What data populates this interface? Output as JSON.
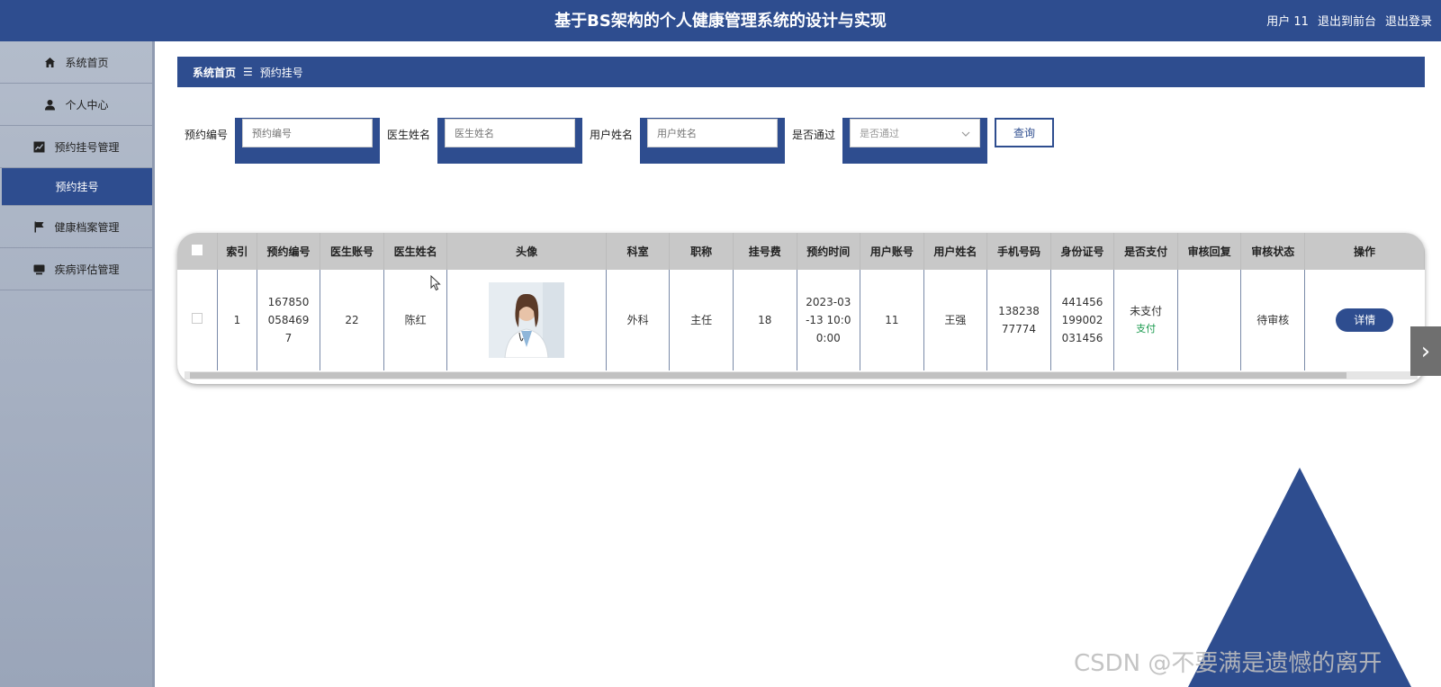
{
  "header": {
    "title": "基于BS架构的个人健康管理系统的设计与实现",
    "user": "用户 11",
    "exit_front": "退出到前台",
    "logout": "退出登录"
  },
  "sidebar": {
    "items": [
      {
        "label": "系统首页",
        "icon": "home-icon"
      },
      {
        "label": "个人中心",
        "icon": "user-icon"
      },
      {
        "label": "预约挂号管理",
        "icon": "chart-icon"
      },
      {
        "label": "预约挂号",
        "icon": ""
      },
      {
        "label": "健康档案管理",
        "icon": "flag-icon"
      },
      {
        "label": "疾病评估管理",
        "icon": "monitor-icon"
      }
    ]
  },
  "breadcrumb": {
    "home": "系统首页",
    "separator": "☰",
    "current": "预约挂号"
  },
  "search": {
    "fields": [
      {
        "label": "预约编号",
        "placeholder": "预约编号"
      },
      {
        "label": "医生姓名",
        "placeholder": "医生姓名"
      },
      {
        "label": "用户姓名",
        "placeholder": "用户姓名"
      },
      {
        "label": "是否通过",
        "placeholder": "是否通过"
      }
    ],
    "query_label": "查询"
  },
  "table": {
    "columns": [
      "索引",
      "预约编号",
      "医生账号",
      "医生姓名",
      "头像",
      "科室",
      "职称",
      "挂号费",
      "预约时间",
      "用户账号",
      "用户姓名",
      "手机号码",
      "身份证号",
      "是否支付",
      "审核回复",
      "审核状态",
      "操作"
    ],
    "rows": [
      {
        "index": "1",
        "appointment_no": "1678500584697",
        "doctor_account": "22",
        "doctor_name": "陈红",
        "department": "外科",
        "title": "主任",
        "fee": "18",
        "appointment_time": "2023-03-13 10:00:00",
        "user_account": "11",
        "user_name": "王强",
        "phone": "13823877774",
        "id_card": "441456199002031456",
        "paid_status": "未支付",
        "pay_link": "支付",
        "review_reply": "",
        "review_status": "待审核",
        "detail_label": "详情"
      }
    ]
  },
  "watermark": "CSDN @不要满是遗憾的离开",
  "colors": {
    "primary": "#2e4d8f",
    "sidebar": "#a9b3c5",
    "pay_link": "#1a9a4e"
  }
}
